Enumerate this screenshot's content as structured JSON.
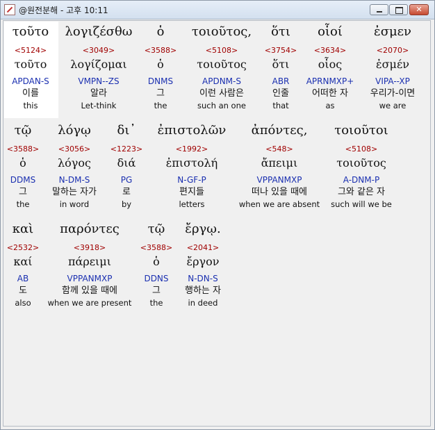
{
  "window": {
    "title": "@원전분해 - 고후 10:11",
    "minimize_label": "",
    "maximize_label": "",
    "close_label": "✕"
  },
  "rows": [
    [
      {
        "greek": "τοῦτο",
        "strong": "<5124>",
        "lemma": "τοῦτο",
        "parsing": "APDAN-S",
        "korean": "이를",
        "english": "this"
      },
      {
        "greek": "λογιζέσθω",
        "strong": "<3049>",
        "lemma": "λογίζομαι",
        "parsing": "VMPN--ZS",
        "korean": "알라",
        "english": "Let-think"
      },
      {
        "greek": "ὁ",
        "strong": "<3588>",
        "lemma": "ὁ",
        "parsing": "DNMS",
        "korean": "그",
        "english": "the"
      },
      {
        "greek": "τοιοῦτος,",
        "strong": "<5108>",
        "lemma": "τοιοῦτος",
        "parsing": "APDNM-S",
        "korean": "이런 사람은",
        "english": "such an one"
      },
      {
        "greek": "ὅτι",
        "strong": "<3754>",
        "lemma": "ὅτι",
        "parsing": "ABR",
        "korean": "인줄",
        "english": "that"
      },
      {
        "greek": "οἷοί",
        "strong": "<3634>",
        "lemma": "οἷος",
        "parsing": "APRNMXP+",
        "korean": "어떠한 자",
        "english": "as"
      },
      {
        "greek": "ἐσμεν",
        "strong": "<2070>",
        "lemma": "ἐσμέν",
        "parsing": "VIPA--XP",
        "korean": "우리가-이면",
        "english": "we are"
      }
    ],
    [
      {
        "greek": "τῷ",
        "strong": "<3588>",
        "lemma": "ὁ",
        "parsing": "DDMS",
        "korean": "그",
        "english": "the"
      },
      {
        "greek": "λόγῳ",
        "strong": "<3056>",
        "lemma": "λόγος",
        "parsing": "N-DM-S",
        "korean": "말하는 자가",
        "english": "in word"
      },
      {
        "greek": "δι᾽",
        "strong": "<1223>",
        "lemma": "διά",
        "parsing": "PG",
        "korean": "로",
        "english": "by"
      },
      {
        "greek": "ἐπιστολῶν",
        "strong": "<1992>",
        "lemma": "ἐπιστολή",
        "parsing": "N-GF-P",
        "korean": "편지들",
        "english": "letters"
      },
      {
        "greek": "ἀπόντες,",
        "strong": "<548>",
        "lemma": "ἄπειμι",
        "parsing": "VPPANMXP",
        "korean": "떠나 있을 때에",
        "english": "when we are absent"
      },
      {
        "greek": "τοιοῦτοι",
        "strong": "<5108>",
        "lemma": "τοιοῦτος",
        "parsing": "A-DNM-P",
        "korean": "그와 같은 자",
        "english": "such will we be"
      }
    ],
    [
      {
        "greek": "καὶ",
        "strong": "<2532>",
        "lemma": "καί",
        "parsing": "AB",
        "korean": "도",
        "english": "also"
      },
      {
        "greek": "παρόντες",
        "strong": "<3918>",
        "lemma": "πάρειμι",
        "parsing": "VPPANMXP",
        "korean": "함께 있을 때에",
        "english": "when we are present"
      },
      {
        "greek": "τῷ",
        "strong": "<3588>",
        "lemma": "ὁ",
        "parsing": "DDNS",
        "korean": "그",
        "english": "the"
      },
      {
        "greek": "ἔργῳ.",
        "strong": "<2041>",
        "lemma": "ἔργον",
        "parsing": "N-DN-S",
        "korean": "행하는 자",
        "english": "in deed"
      }
    ]
  ]
}
